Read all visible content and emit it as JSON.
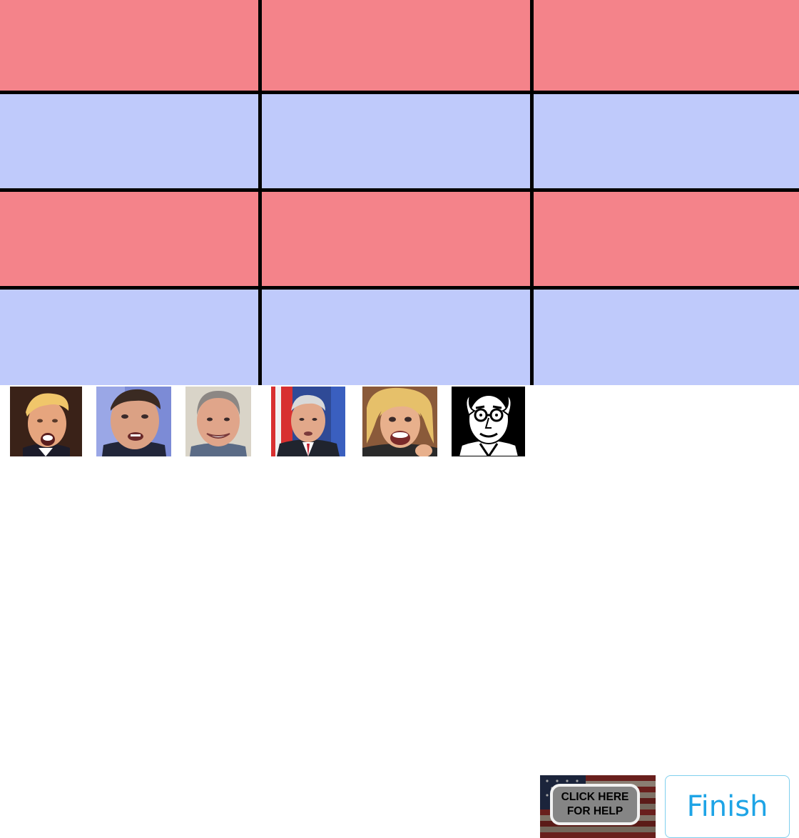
{
  "board": {
    "rows": [
      {
        "party": "republican",
        "color": "#f4838a"
      },
      {
        "party": "democrat",
        "color": "#bfcafb"
      },
      {
        "party": "republican",
        "color": "#f4838a"
      },
      {
        "party": "democrat",
        "color": "#bfcafb"
      }
    ],
    "columns": 3
  },
  "candidates": [
    {
      "id": "candidate-1",
      "bg": "#3a2218"
    },
    {
      "id": "candidate-2",
      "bg": "#7c8bd6"
    },
    {
      "id": "candidate-3",
      "bg": "#d9d4c8"
    },
    {
      "id": "candidate-4",
      "bg": "#2f4a96"
    },
    {
      "id": "candidate-5",
      "bg": "#8a5a3a"
    },
    {
      "id": "candidate-6",
      "bg": "#000000"
    }
  ],
  "help": {
    "line1": "CLICK HERE",
    "line2": "FOR HELP"
  },
  "finish": {
    "label": "Finish",
    "color": "#1ea4e6"
  }
}
